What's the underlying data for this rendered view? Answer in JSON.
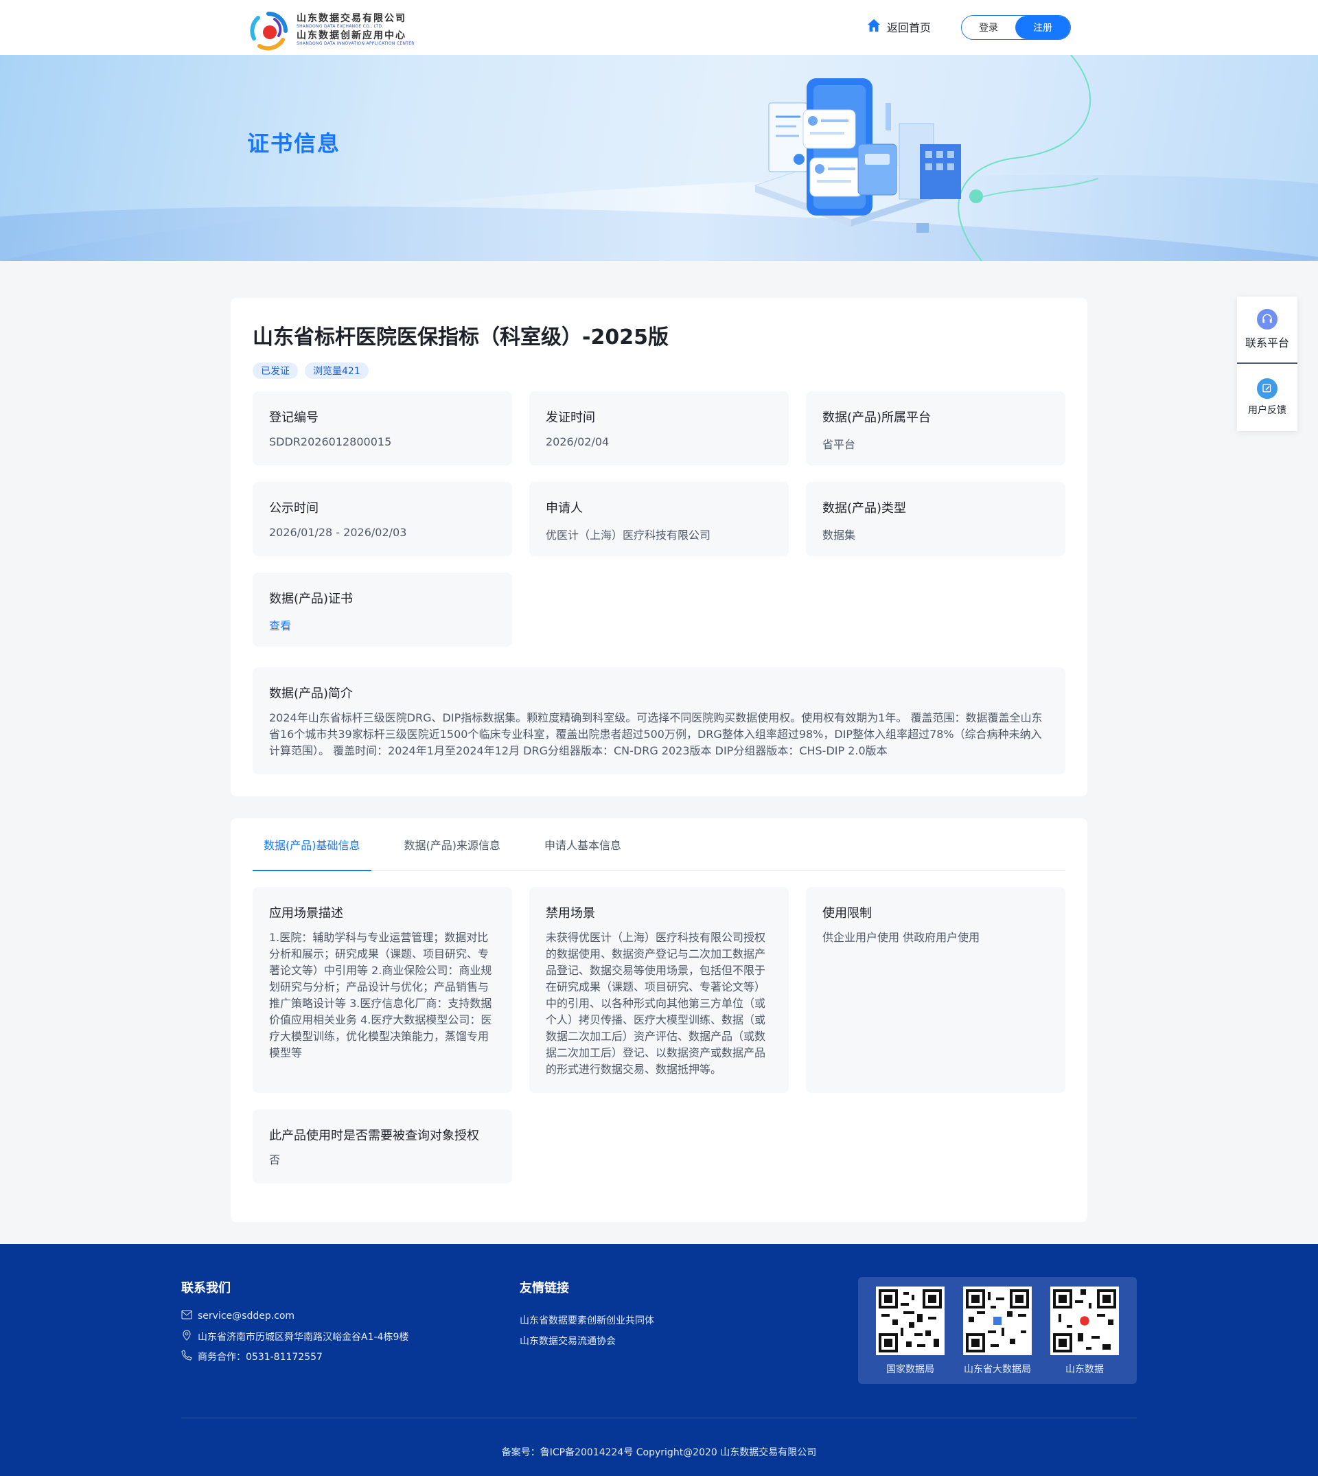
{
  "header": {
    "logo": {
      "line1": "山东数据交易有限公司",
      "line1_en": "SHANDONG DATA EXCHANGE CO., LTD.",
      "line2": "山东数据创新应用中心",
      "line2_en": "SHANDONG DATA INNOVATION APPLICATION CENTER"
    },
    "home_label": "返回首页",
    "login_label": "登录",
    "register_label": "注册"
  },
  "banner": {
    "title": "证书信息"
  },
  "product": {
    "title": "山东省标杆医院医保指标（科室级）-2025版",
    "tags": [
      "已发证",
      "浏览量421"
    ],
    "fields": [
      {
        "label": "登记编号",
        "value": "SDDR2026012800015"
      },
      {
        "label": "发证时间",
        "value": "2026/02/04"
      },
      {
        "label": "数据(产品)所属平台",
        "value": "省平台"
      },
      {
        "label": "公示时间",
        "value": "2026/01/28 - 2026/02/03"
      },
      {
        "label": "申请人",
        "value": "优医计（上海）医疗科技有限公司"
      },
      {
        "label": "数据(产品)类型",
        "value": "数据集"
      },
      {
        "label": "数据(产品)证书",
        "value": "查看"
      }
    ],
    "intro": {
      "label": "数据(产品)简介",
      "text": "2024年山东省标杆三级医院DRG、DIP指标数据集。颗粒度精确到科室级。可选择不同医院购买数据使用权。使用权有效期为1年。 覆盖范围：数据覆盖全山东省16个城市共39家标杆三级医院近1500个临床专业科室，覆盖出院患者超过500万例，DRG整体入组率超过98%，DIP整体入组率超过78%（综合病种未纳入计算范围）。 覆盖时间：2024年1月至2024年12月 DRG分组器版本：CN-DRG 2023版本 DIP分组器版本：CHS-DIP 2.0版本"
    }
  },
  "details": {
    "tabs": [
      "数据(产品)基础信息",
      "数据(产品)来源信息",
      "申请人基本信息"
    ],
    "active_tab": 0,
    "boxes": [
      {
        "label": "应用场景描述",
        "value": "1.医院：辅助学科与专业运营管理；数据对比分析和展示；研究成果（课题、项目研究、专著论文等）中引用等 2.商业保险公司：商业规划研究与分析；产品设计与优化；产品销售与推广策略设计等 3.医疗信息化厂商：支持数据价值应用相关业务 4.医疗大数据模型公司：医疗大模型训练，优化模型决策能力，蒸馏专用模型等"
      },
      {
        "label": "禁用场景",
        "value": "未获得优医计（上海）医疗科技有限公司授权的数据使用、数据资产登记与二次加工数据产品登记、数据交易等使用场景，包括但不限于在研究成果（课题、项目研究、专著论文等）中的引用、以各种形式向其他第三方单位（或个人）拷贝传播、医疗大模型训练、数据（或数据二次加工后）资产评估、数据产品（或数据二次加工后）登记、以数据资产或数据产品的形式进行数据交易、数据抵押等。"
      },
      {
        "label": "使用限制",
        "value": "供企业用户使用 供政府用户使用"
      },
      {
        "label": "此产品使用时是否需要被查询对象授权",
        "value": "否"
      }
    ]
  },
  "side_float": {
    "contact_label": "联系平台",
    "feedback_label": "用户反馈"
  },
  "footer": {
    "contact": {
      "title": "联系我们",
      "email": "service@sddep.com",
      "address": "山东省济南市历城区舜华南路汉峪金谷A1-4栋9楼",
      "phone": "商务合作：0531-81172557"
    },
    "links": {
      "title": "友情链接",
      "items": [
        "山东省数据要素创新创业共同体",
        "山东数据交易流通协会"
      ]
    },
    "qrcodes": [
      "国家数据局",
      "山东省大数据局",
      "山东数据"
    ],
    "copyright": "备案号：鲁ICP备20014224号 Copyright@2020 山东数据交易有限公司"
  },
  "colors": {
    "primary": "#1677ff",
    "footer_bg": "#063696",
    "panel_bg": "#f7f8fa"
  }
}
